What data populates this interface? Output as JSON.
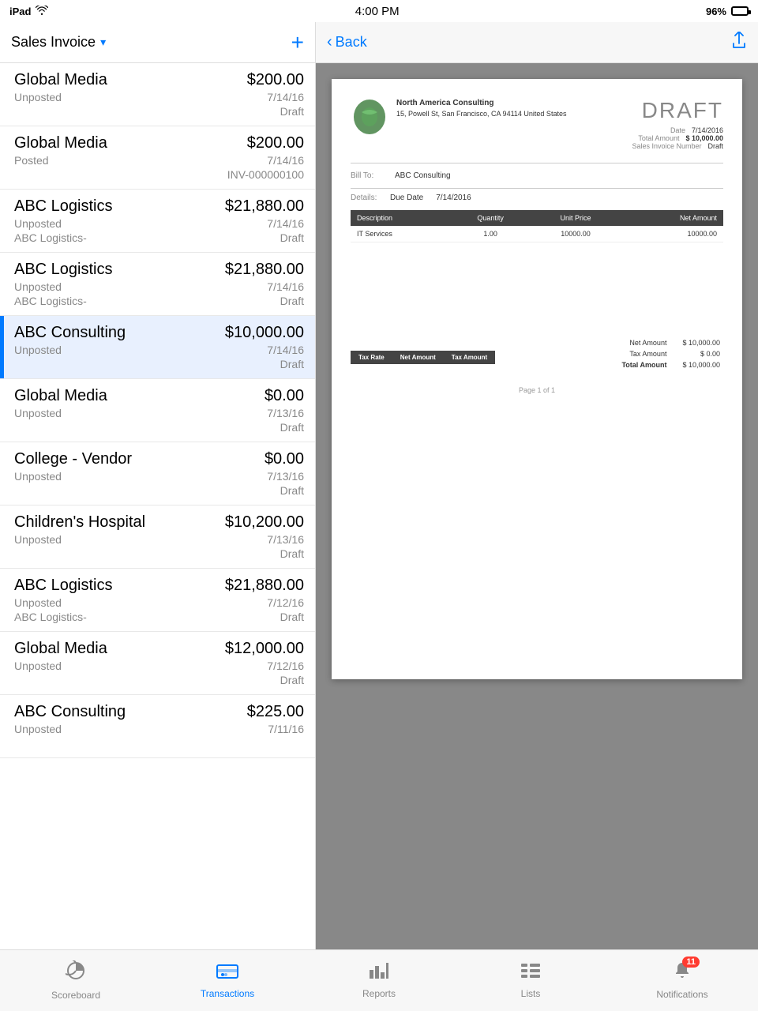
{
  "statusBar": {
    "device": "iPad",
    "time": "4:00 PM",
    "battery": "96%"
  },
  "leftPanel": {
    "header": {
      "title": "Sales Invoice",
      "addLabel": "+"
    },
    "invoices": [
      {
        "name": "Global Media",
        "amount": "$200.00",
        "status": "Unposted",
        "date": "7/14/16",
        "ref": "Draft",
        "active": false
      },
      {
        "name": "Global Media",
        "amount": "$200.00",
        "status": "Posted",
        "date": "7/14/16",
        "ref": "INV-000000100",
        "active": false
      },
      {
        "name": "ABC Logistics",
        "amount": "$21,880.00",
        "status": "Unposted",
        "date": "7/14/16",
        "ref": "Draft",
        "refLeft": "ABC Logistics-",
        "active": false
      },
      {
        "name": "ABC Logistics",
        "amount": "$21,880.00",
        "status": "Unposted",
        "date": "7/14/16",
        "ref": "Draft",
        "refLeft": "ABC Logistics-",
        "active": false
      },
      {
        "name": "ABC Consulting",
        "amount": "$10,000.00",
        "status": "Unposted",
        "date": "7/14/16",
        "ref": "Draft",
        "active": true
      },
      {
        "name": "Global Media",
        "amount": "$0.00",
        "status": "Unposted",
        "date": "7/13/16",
        "ref": "Draft",
        "active": false
      },
      {
        "name": "College - Vendor",
        "amount": "$0.00",
        "status": "Unposted",
        "date": "7/13/16",
        "ref": "Draft",
        "active": false
      },
      {
        "name": "Children's Hospital",
        "amount": "$10,200.00",
        "status": "Unposted",
        "date": "7/13/16",
        "ref": "Draft",
        "active": false
      },
      {
        "name": "ABC Logistics",
        "amount": "$21,880.00",
        "status": "Unposted",
        "date": "7/12/16",
        "ref": "Draft",
        "refLeft": "ABC Logistics-",
        "active": false
      },
      {
        "name": "Global Media",
        "amount": "$12,000.00",
        "status": "Unposted",
        "date": "7/12/16",
        "ref": "Draft",
        "active": false
      },
      {
        "name": "ABC Consulting",
        "amount": "$225.00",
        "status": "Unposted",
        "date": "7/11/16",
        "ref": "",
        "active": false
      }
    ]
  },
  "rightPanel": {
    "header": {
      "backLabel": "Back"
    },
    "document": {
      "companyName": "North America Consulting",
      "companyAddress": "15, Powell St, San Francisco, CA 94114 United States",
      "draftTitle": "DRAFT",
      "dateLabel": "Date",
      "dateValue": "7/14/2016",
      "totalAmountLabel": "Total Amount",
      "totalAmountValue": "$ 10,000.00",
      "salesInvoiceLabel": "Sales Invoice Number",
      "salesInvoiceValue": "Draft",
      "billToLabel": "Bill To:",
      "billToValue": "ABC Consulting",
      "detailsLabel": "Details:",
      "dueDateLabel": "Due Date",
      "dueDateValue": "7/14/2016",
      "tableHeaders": [
        "Description",
        "Quantity",
        "Unit Price",
        "Net Amount"
      ],
      "tableRows": [
        {
          "description": "IT Services",
          "quantity": "1.00",
          "unitPrice": "10000.00",
          "netAmount": "10000.00"
        }
      ],
      "taxTableHeaders": [
        "Tax Rate",
        "Net Amount",
        "Tax Amount"
      ],
      "taxTableRows": [],
      "netAmountLabel": "Net Amount",
      "netAmountValue": "$ 10,000.00",
      "taxAmountLabel": "Tax Amount",
      "taxAmountValue": "$ 0.00",
      "totalAmountFooterLabel": "Total Amount",
      "totalAmountFooterValue": "$ 10,000.00",
      "pageText": "Page 1 of 1"
    }
  },
  "tabBar": {
    "items": [
      {
        "id": "scoreboard",
        "label": "Scoreboard",
        "icon": "pie",
        "active": false,
        "badge": null
      },
      {
        "id": "transactions",
        "label": "Transactions",
        "icon": "credit-card",
        "active": true,
        "badge": null
      },
      {
        "id": "reports",
        "label": "Reports",
        "icon": "bar-chart",
        "active": false,
        "badge": null
      },
      {
        "id": "lists",
        "label": "Lists",
        "icon": "list",
        "active": false,
        "badge": null
      },
      {
        "id": "notifications",
        "label": "Notifications",
        "icon": "bell",
        "active": false,
        "badge": "11"
      }
    ]
  }
}
